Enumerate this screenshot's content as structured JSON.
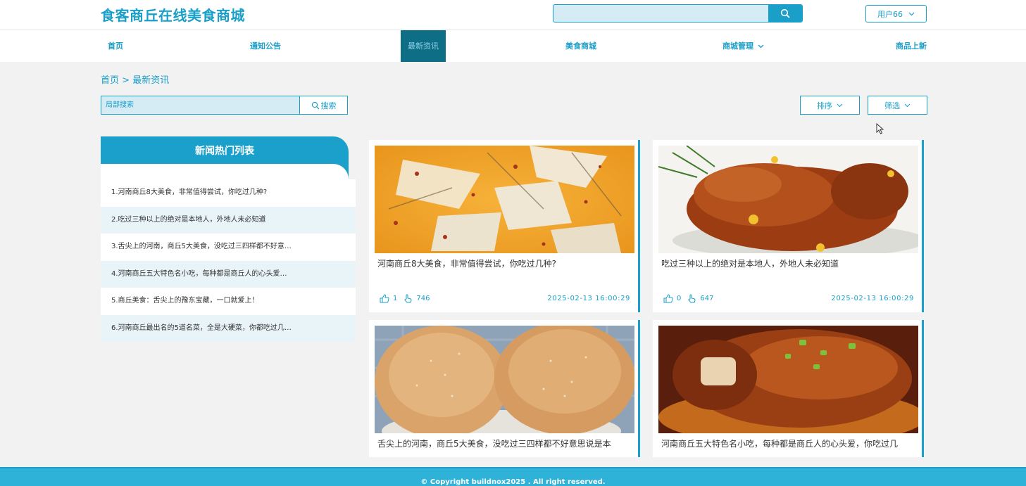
{
  "header": {
    "site_title": "食客商丘在线美食商城",
    "search_placeholder": "",
    "user_label": "用户66"
  },
  "nav": {
    "items": [
      {
        "label": "首页"
      },
      {
        "label": "通知公告"
      },
      {
        "label": "最新资讯"
      },
      {
        "label": "美食商城"
      },
      {
        "label": "商城管理"
      },
      {
        "label": "商品上新"
      }
    ],
    "active": "最新资讯"
  },
  "breadcrumb": {
    "home": "首页",
    "separator": ">",
    "current": "最新资讯"
  },
  "toolbar": {
    "local_search_placeholder": "局部搜索",
    "search_button": "搜索",
    "sort_button": "排序",
    "filter_button": "筛选"
  },
  "hot_list": {
    "title": "新闻热门列表",
    "items": [
      "1.河南商丘8大美食，非常值得尝试，你吃过几种?",
      "2.吃过三种以上的绝对是本地人，外地人未必知道",
      "3.舌尖上的河南，商丘5大美食，没吃过三四样都不好意…",
      "4.河南商丘五大特色名小吃，每种都是商丘人的心头爱…",
      "5.商丘美食：舌尖上的豫东宝藏，一口就爱上！",
      "6.河南商丘最出名的5道名菜，全是大硬菜，你都吃过几…"
    ]
  },
  "news_cards": [
    {
      "title": "河南商丘8大美食，非常值得尝试，你吃过几种?",
      "likes": "1",
      "clicks": "746",
      "date": "2025-02-13 16:00:29",
      "image": "fish-soup"
    },
    {
      "title": "吃过三种以上的绝对是本地人，外地人未必知道",
      "likes": "0",
      "clicks": "647",
      "date": "2025-02-13 16:00:29",
      "image": "roast-chicken"
    },
    {
      "title": "舌尖上的河南，商丘5大美食，没吃过三四样都不好意思说是本",
      "image": "sesame-flatbread"
    },
    {
      "title": "河南商丘五大特色名小吃，每种都是商丘人的心头爱，你吃过几",
      "image": "braised-pork"
    }
  ],
  "footer": {
    "copyright": "© Copyright buildnox2025 . All right reserved."
  },
  "colors": {
    "accent": "#1a9fc9",
    "nav_active_bg": "#0e6e86",
    "footer_bg": "#2eb2d8"
  }
}
